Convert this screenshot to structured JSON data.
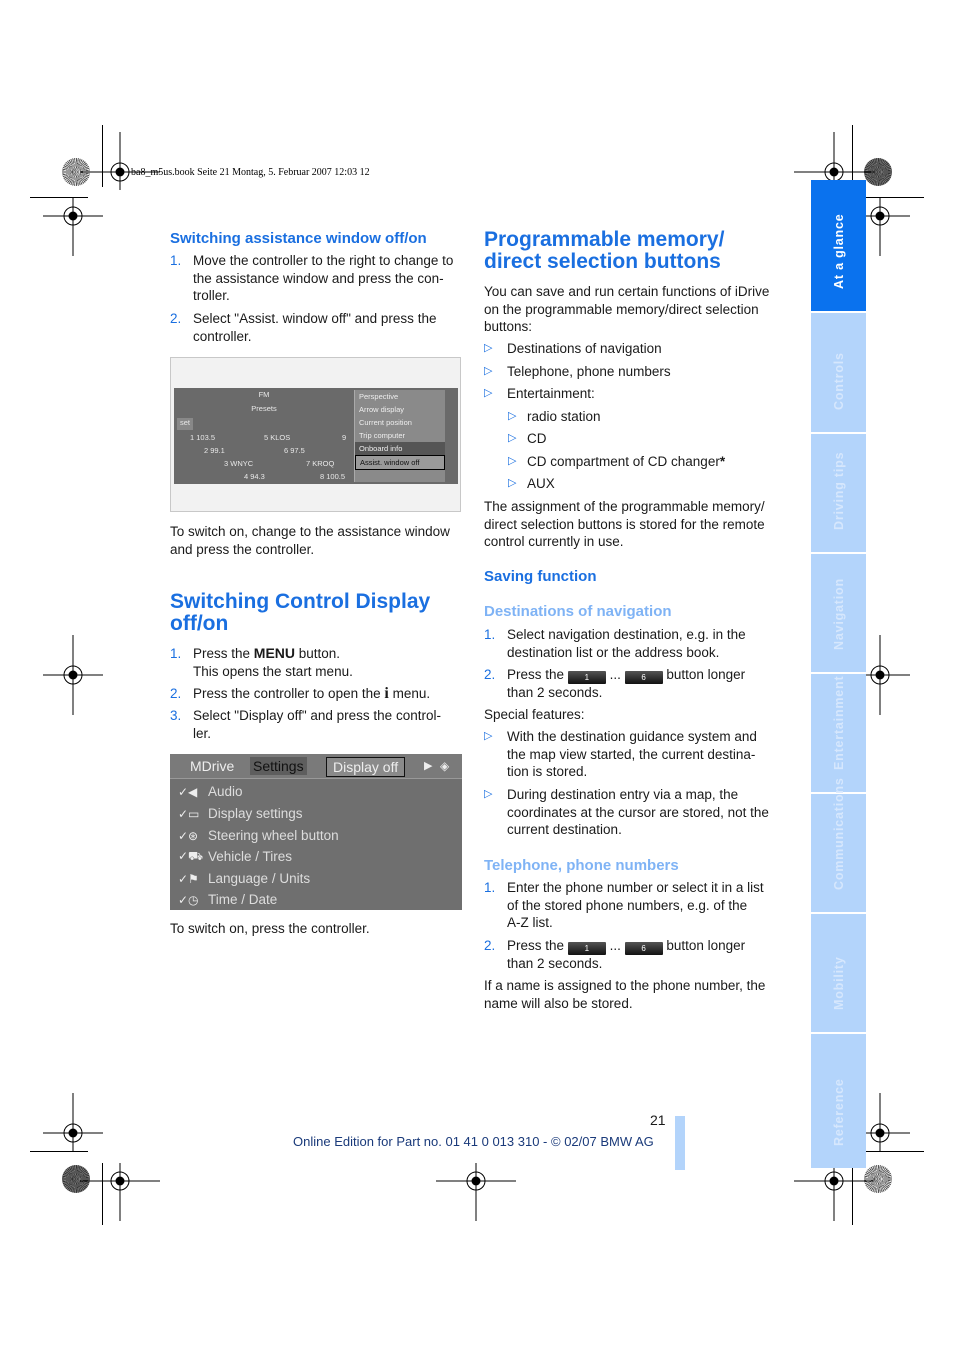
{
  "print_meta": "ba8_m5us.book  Seite 21  Montag, 5. Februar 2007  12:03 12",
  "left": {
    "assist_heading": "Switching assistance window off/on",
    "assist_steps": [
      {
        "num": "1.",
        "lines": [
          "Move the controller to the right to change to",
          "the assistance window and press the con-",
          "troller."
        ]
      },
      {
        "num": "2.",
        "lines": [
          "Select \"Assist. window off\" and press the",
          "controller."
        ]
      }
    ],
    "screenshot1": {
      "top_label": "FM",
      "presets_label": "Presets",
      "set_label": "set",
      "rows": [
        [
          "1 103.5",
          "5 KLOS",
          "9"
        ],
        [
          "2 99.1",
          "6 97.5",
          ""
        ],
        [
          "3 WNYC",
          "7 KROQ",
          ""
        ],
        [
          "4 94.3",
          "8 100.5",
          ""
        ]
      ],
      "popup": [
        "Perspective",
        "Arrow display",
        "Current position",
        "Trip computer",
        "Onboard info",
        "Assist. window off"
      ]
    },
    "assist_after": [
      "To switch on, change to the assistance window",
      "and press the controller."
    ],
    "display_heading": [
      "Switching Control Display",
      "off/on"
    ],
    "display_steps": [
      {
        "num": "1.",
        "pre": "Press the ",
        "bold": "MENU",
        "post": " button.",
        "line2": "This opens the start menu."
      },
      {
        "num": "2.",
        "pre": "Press the controller to open the ",
        "icon": "i",
        "post": " menu."
      },
      {
        "num": "3.",
        "lines": [
          "Select \"Display off\" and press the control-",
          "ler."
        ]
      }
    ],
    "screenshot2": {
      "tabs": [
        "MDrive",
        "Settings",
        "Display off"
      ],
      "items": [
        {
          "icon": "audio-icon",
          "label": "Audio"
        },
        {
          "icon": "display-icon",
          "label": "Display settings"
        },
        {
          "icon": "steering-wheel-icon",
          "label": "Steering wheel button"
        },
        {
          "icon": "vehicle-icon",
          "label": "Vehicle / Tires"
        },
        {
          "icon": "flag-icon",
          "label": "Language / Units"
        },
        {
          "icon": "clock-icon",
          "label": "Time / Date"
        }
      ]
    },
    "display_after": "To switch on, press the controller."
  },
  "right": {
    "heading": [
      "Programmable memory/",
      "direct selection buttons"
    ],
    "intro": [
      "You can save and run certain functions of iDrive",
      "on the programmable memory/direct selection",
      "buttons:"
    ],
    "bullets": [
      "Destinations of navigation",
      "Telephone, phone numbers",
      "Entertainment:"
    ],
    "sub_bullets": [
      "radio station",
      "CD",
      "CD compartment of CD changer",
      "AUX"
    ],
    "asterisk": "*",
    "assignment": [
      "The assignment of the programmable memory/",
      "direct selection buttons is stored for the remote",
      "control currently in use."
    ],
    "saving_heading": "Saving function",
    "nav_heading": "Destinations of navigation",
    "nav_step1": [
      "Select navigation destination, e.g. in the",
      "destination list or the address book."
    ],
    "press_the": "Press the",
    "key1": "1",
    "ellipsis": "...",
    "key6": "6",
    "button_longer": "button longer",
    "than_2": "than 2 seconds.",
    "special": "Special features:",
    "special_bullets": [
      [
        "With the destination guidance system and",
        "the map view started, the current destina-",
        "tion is stored."
      ],
      [
        "During destination entry via a map, the",
        "coordinates at the cursor are stored, not the",
        "current destination."
      ]
    ],
    "phone_heading": "Telephone, phone numbers",
    "phone_step1": [
      "Enter the phone number or select it in a list",
      "of the stored phone numbers, e.g. of the",
      "A-Z list."
    ],
    "phone_after": [
      "If a name is assigned to the phone number, the",
      "name will also be stored."
    ]
  },
  "side_tabs": [
    {
      "label": "At a glance",
      "active": true
    },
    {
      "label": "Controls",
      "active": false
    },
    {
      "label": "Driving tips",
      "active": false
    },
    {
      "label": "Navigation",
      "active": false
    },
    {
      "label": "Entertainment",
      "active": false
    },
    {
      "label": "Communications",
      "active": false
    },
    {
      "label": "Mobility",
      "active": false
    },
    {
      "label": "Reference",
      "active": false
    }
  ],
  "footer": {
    "page_number": "21",
    "edition": "Online Edition for Part no. 01 41 0 013 310 - © 02/07 BMW AG"
  }
}
